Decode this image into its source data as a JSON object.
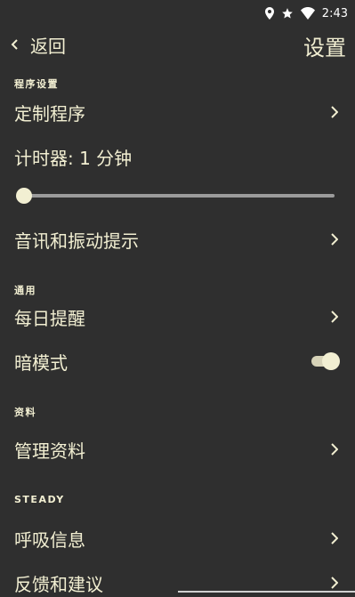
{
  "status": {
    "time": "2:43"
  },
  "toolbar": {
    "back_label": "返回",
    "title": "设置"
  },
  "sections": {
    "program": "程序设置",
    "general": "通用",
    "profile": "资料",
    "steady": "STEADY"
  },
  "items": {
    "custom_program": "定制程序",
    "timer": "计时器: 1 分钟",
    "sound_vibration": "音讯和振动提示",
    "daily_reminder": "每日提醒",
    "dark_mode": "暗模式",
    "manage_profile": "管理资料",
    "breathing_info": "呼吸信息",
    "feedback": "反馈和建议"
  },
  "timer_slider": {
    "value_fraction": 0.0
  },
  "dark_mode_toggle": {
    "on": true
  },
  "colors": {
    "background": "#2f2f2f",
    "text": "#f2efd2",
    "slider_track": "#9b9b9b"
  }
}
